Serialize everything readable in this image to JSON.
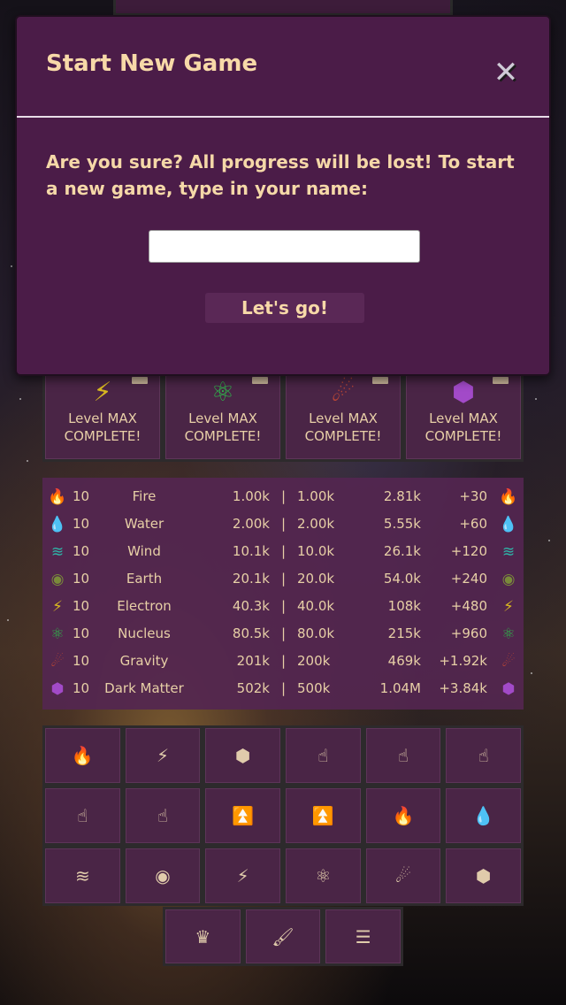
{
  "modal": {
    "title": "Start New Game",
    "message": "Are you sure? All progress will be lost! To start a new game, type in your name:",
    "input_value": "",
    "input_placeholder": "",
    "go_label": "Let's go!",
    "close_icon": "close-icon"
  },
  "cards": [
    {
      "icon": "electron-icon",
      "glyph": "⚡",
      "color": "#d8b820",
      "level": "Level MAX",
      "status": "COMPLETE!"
    },
    {
      "icon": "nucleus-icon",
      "glyph": "⚛",
      "color": "#2fb34a",
      "level": "Level MAX",
      "status": "COMPLETE!"
    },
    {
      "icon": "gravity-icon",
      "glyph": "☄",
      "color": "#b84535",
      "level": "Level MAX",
      "status": "COMPLETE!"
    },
    {
      "icon": "dark-matter-icon",
      "glyph": "⬢",
      "color": "#a24ac8",
      "level": "Level MAX",
      "status": "COMPLETE!"
    }
  ],
  "stats": [
    {
      "icon": "fire-icon",
      "glyph": "🔥",
      "color": "#e0602a",
      "level": "10",
      "name": "Fire",
      "a": "1.00k",
      "sep": "|",
      "b": "1.00k",
      "c": "2.81k",
      "d": "+30"
    },
    {
      "icon": "water-icon",
      "glyph": "💧",
      "color": "#3a8fd6",
      "level": "10",
      "name": "Water",
      "a": "2.00k",
      "sep": "|",
      "b": "2.00k",
      "c": "5.55k",
      "d": "+60"
    },
    {
      "icon": "wind-icon",
      "glyph": "≋",
      "color": "#2fb5a8",
      "level": "10",
      "name": "Wind",
      "a": "10.1k",
      "sep": "|",
      "b": "10.0k",
      "c": "26.1k",
      "d": "+120"
    },
    {
      "icon": "earth-icon",
      "glyph": "◉",
      "color": "#7a8a3a",
      "level": "10",
      "name": "Earth",
      "a": "20.1k",
      "sep": "|",
      "b": "20.0k",
      "c": "54.0k",
      "d": "+240"
    },
    {
      "icon": "electron-icon",
      "glyph": "⚡",
      "color": "#d8b820",
      "level": "10",
      "name": "Electron",
      "a": "40.3k",
      "sep": "|",
      "b": "40.0k",
      "c": "108k",
      "d": "+480"
    },
    {
      "icon": "nucleus-icon",
      "glyph": "⚛",
      "color": "#2fb34a",
      "level": "10",
      "name": "Nucleus",
      "a": "80.5k",
      "sep": "|",
      "b": "80.0k",
      "c": "215k",
      "d": "+960"
    },
    {
      "icon": "gravity-icon",
      "glyph": "☄",
      "color": "#b84535",
      "level": "10",
      "name": "Gravity",
      "a": "201k",
      "sep": "|",
      "b": "200k",
      "c": "469k",
      "d": "+1.92k"
    },
    {
      "icon": "dark-matter-icon",
      "glyph": "⬢",
      "color": "#a24ac8",
      "level": "10",
      "name": "Dark Matter",
      "a": "502k",
      "sep": "|",
      "b": "500k",
      "c": "1.04M",
      "d": "+3.84k"
    }
  ],
  "grid_buttons": [
    {
      "icon": "fire-icon",
      "glyph": "🔥"
    },
    {
      "icon": "electron-icon",
      "glyph": "⚡"
    },
    {
      "icon": "dark-matter-icon",
      "glyph": "⬢"
    },
    {
      "icon": "hand-pointer-icon",
      "glyph": "☝"
    },
    {
      "icon": "hand-pointer-icon",
      "glyph": "☝"
    },
    {
      "icon": "hand-pointer-icon",
      "glyph": "☝"
    },
    {
      "icon": "hand-pointer-icon",
      "glyph": "☝"
    },
    {
      "icon": "hand-pointer-icon",
      "glyph": "☝"
    },
    {
      "icon": "double-chevron-up-icon",
      "glyph": "⏫"
    },
    {
      "icon": "double-chevron-up-icon",
      "glyph": "⏫"
    },
    {
      "icon": "fire-icon",
      "glyph": "🔥"
    },
    {
      "icon": "water-icon",
      "glyph": "💧"
    },
    {
      "icon": "wind-icon",
      "glyph": "≋"
    },
    {
      "icon": "earth-icon",
      "glyph": "◉"
    },
    {
      "icon": "electron-icon",
      "glyph": "⚡"
    },
    {
      "icon": "nucleus-icon",
      "glyph": "⚛"
    },
    {
      "icon": "gravity-icon",
      "glyph": "☄"
    },
    {
      "icon": "dark-matter-icon",
      "glyph": "⬢"
    }
  ],
  "bottom_buttons": [
    {
      "icon": "crown-icon",
      "glyph": "♛"
    },
    {
      "icon": "paintbrush-icon",
      "glyph": "🖌"
    },
    {
      "icon": "layers-icon",
      "glyph": "☰"
    }
  ]
}
